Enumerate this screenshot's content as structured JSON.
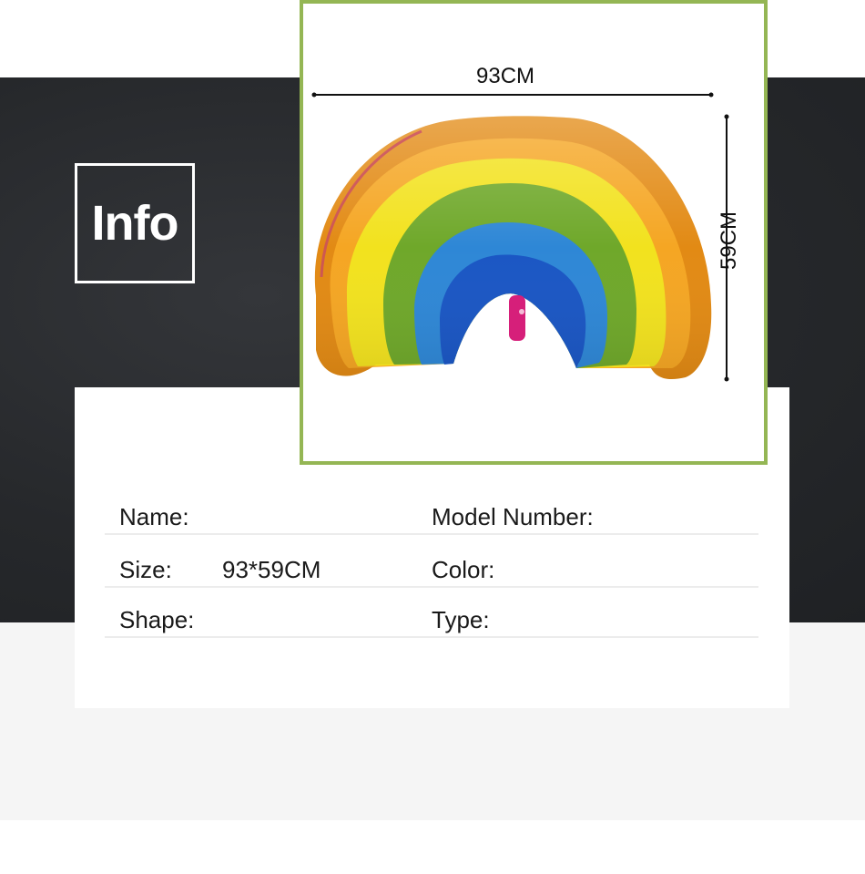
{
  "badge": {
    "label": "Info"
  },
  "product_image": {
    "width_label": "93CM",
    "height_label": "59CM",
    "subject": "rainbow-foil-balloon"
  },
  "specs": {
    "name_label": "Name:",
    "name_value": "",
    "model_label": "Model Number:",
    "model_value": "",
    "size_label": "Size:",
    "size_value": "93*59CM",
    "color_label": "Color:",
    "color_value": "",
    "shape_label": "Shape:",
    "shape_value": "",
    "type_label": "Type:",
    "type_value": ""
  },
  "colors": {
    "frame": "#94b654",
    "dark_band": "#26282b",
    "light_band": "#f5f5f5"
  }
}
